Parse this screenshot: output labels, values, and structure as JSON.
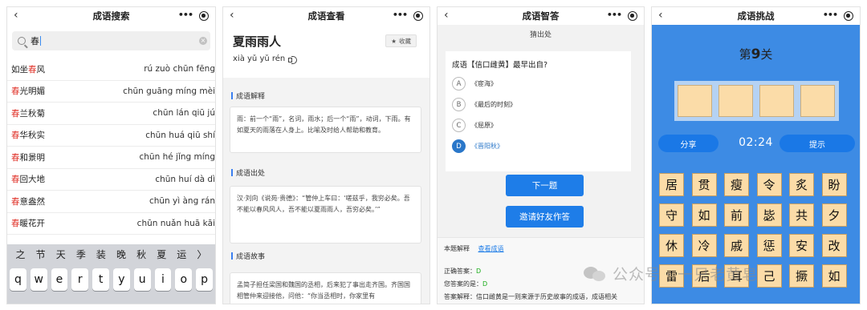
{
  "icons": {
    "back": "chevron-left-icon",
    "more": "more-dots-icon",
    "close": "target-close-icon",
    "search": "search-icon",
    "clear": "clear-icon",
    "speaker": "speaker-icon",
    "star": "star-icon"
  },
  "nav_common": {
    "back": "‹",
    "more": "•••"
  },
  "screen1": {
    "title": "成语搜索",
    "search_value": "春",
    "results": [
      {
        "pre": "如坐",
        "hl": "春",
        "post": "风",
        "pinyin": "rú zuò chūn fēng"
      },
      {
        "pre": "",
        "hl": "春",
        "post": "光明媚",
        "pinyin": "chūn guāng míng mèi"
      },
      {
        "pre": "",
        "hl": "春",
        "post": "兰秋菊",
        "pinyin": "chūn lán qiū jú"
      },
      {
        "pre": "",
        "hl": "春",
        "post": "华秋实",
        "pinyin": "chūn huá qiū shí"
      },
      {
        "pre": "",
        "hl": "春",
        "post": "和景明",
        "pinyin": "chūn hé jǐng míng"
      },
      {
        "pre": "",
        "hl": "春",
        "post": "回大地",
        "pinyin": "chūn huí dà dì"
      },
      {
        "pre": "",
        "hl": "春",
        "post": "意盎然",
        "pinyin": "chūn yì àng rán"
      },
      {
        "pre": "",
        "hl": "春",
        "post": "暖花开",
        "pinyin": "chūn nuǎn huā kāi"
      }
    ],
    "keyboard_suggestions": [
      "之",
      "节",
      "天",
      "季",
      "装",
      "晚",
      "秋",
      "夏",
      "运",
      "〉"
    ],
    "keyboard_row": [
      "q",
      "w",
      "e",
      "r",
      "t",
      "y",
      "u",
      "i",
      "o",
      "p"
    ]
  },
  "screen2": {
    "title": "成语查看",
    "idiom": "夏雨雨人",
    "pinyin": "xià yǔ yǔ rén",
    "fav_label": "收藏",
    "sections": [
      {
        "head": "成语解释",
        "body": "雨：前一个“雨”，名词，雨水；后一个“雨”，动词，下雨。有如夏天的雨落在人身上。比喻及时给人帮助和教育。"
      },
      {
        "head": "成语出处",
        "body": "汉·刘向《说苑·贵德》：“管仲上车曰：‘嗟兹乎，我穷必矣。吾不能以春风风人，吾不能以夏雨雨人，吾穷必矣。’”"
      },
      {
        "head": "成语故事",
        "body": "孟简子担任梁国和魏国的丞相，后来犯了事出走齐国。齐国国相管仲来迎接他，问他：“你当丞相时，你家里有"
      }
    ]
  },
  "screen3": {
    "title": "成语智答",
    "subtitle": "猜出处",
    "question": "成语【信口雌黄】最早出自?",
    "options": [
      {
        "letter": "A",
        "text": "《宦海》"
      },
      {
        "letter": "B",
        "text": "《最后的时刻》"
      },
      {
        "letter": "C",
        "text": "《屈原》"
      },
      {
        "letter": "D",
        "text": "《晋阳秋》"
      }
    ],
    "btn_next": "下一题",
    "btn_invite": "邀请好友作答",
    "bottom_label": "本题解释",
    "bottom_link": "查看成语",
    "correct_label": "正确答案：",
    "correct_value": "D",
    "yours_label": "您答案的是：",
    "yours_value": "D",
    "explain": "答案解释：信口雌黄是一则来源于历史故事的成语，成语相关"
  },
  "screen4": {
    "title": "成语挑战",
    "level_pre": "第",
    "level_num": "9",
    "level_post": "关",
    "share": "分享",
    "timer": "02:24",
    "hint": "提示",
    "tiles": [
      [
        "居",
        "贯",
        "瘦",
        "令",
        "炙",
        "盼"
      ],
      [
        "守",
        "如",
        "前",
        "毖",
        "共",
        "夕"
      ],
      [
        "休",
        "冷",
        "戚",
        "惩",
        "安",
        "改"
      ],
      [
        "雷",
        "后",
        "耳",
        "己",
        "撅",
        "如"
      ]
    ]
  },
  "watermark": {
    "text": "公众号 · 一只老黄皂"
  }
}
